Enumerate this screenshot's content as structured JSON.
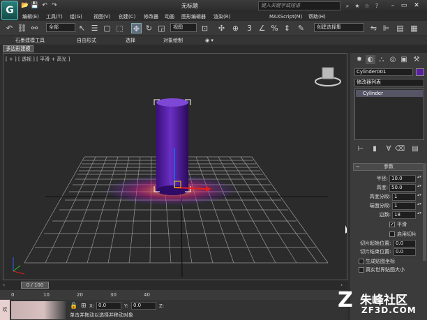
{
  "window": {
    "title": "无标题",
    "search_placeholder": "键入关键字或短语"
  },
  "quick_access": [
    "📂",
    "💾",
    "↶",
    "↷"
  ],
  "menu": [
    "编辑(E)",
    "工具(T)",
    "组(G)",
    "视图(V)",
    "创建(C)",
    "修改器",
    "动画",
    "图形编辑器",
    "渲染(R)",
    "MAXScript(M)",
    "帮助(H)"
  ],
  "toolbar": {
    "selection_filter": "全部",
    "view_dropdown": "视图",
    "named_selection": "创建选择集"
  },
  "ribbon": {
    "tabs": [
      "石墨建模工具",
      "自由形式",
      "选择",
      "对象绘制"
    ],
    "subtab": "多边形建模"
  },
  "viewport": {
    "label": "[ + ] [ 透视 ] [ 平滑 + 高光 ]"
  },
  "command_panel": {
    "object_name": "Cylinder001",
    "object_color": "#5a1fa0",
    "modifier_list": "修改器列表",
    "stack_item": "Cylinder",
    "rollout_title": "参数",
    "params": [
      {
        "label": "半径:",
        "value": "10.0"
      },
      {
        "label": "高度:",
        "value": "50.0"
      },
      {
        "label": "高度分段:",
        "value": "1"
      },
      {
        "label": "端面分段:",
        "value": "1"
      },
      {
        "label": "边数:",
        "value": "18"
      }
    ],
    "checkbox_smooth": "平滑",
    "checkbox_slice": "启用切片",
    "slice_from_label": "切片起始位置:",
    "slice_from": "0.0",
    "slice_to_label": "切片结束位置:",
    "slice_to": "0.0",
    "gen_uv": "生成贴图坐标",
    "real_world": "真实世界贴图大小"
  },
  "time": {
    "frame": "0 / 100",
    "ticks": [
      "0",
      "10",
      "20",
      "30",
      "40"
    ]
  },
  "status": {
    "x_label": "X:",
    "x_value": "0.0",
    "y_label": "Y:",
    "y_value": "0.0",
    "z_label": "Z:",
    "prompt": "单击并拖动以选择并移动对象",
    "mode_label": "欢"
  },
  "watermark": {
    "line1": "朱峰社区",
    "line2": "ZF3D.COM"
  }
}
